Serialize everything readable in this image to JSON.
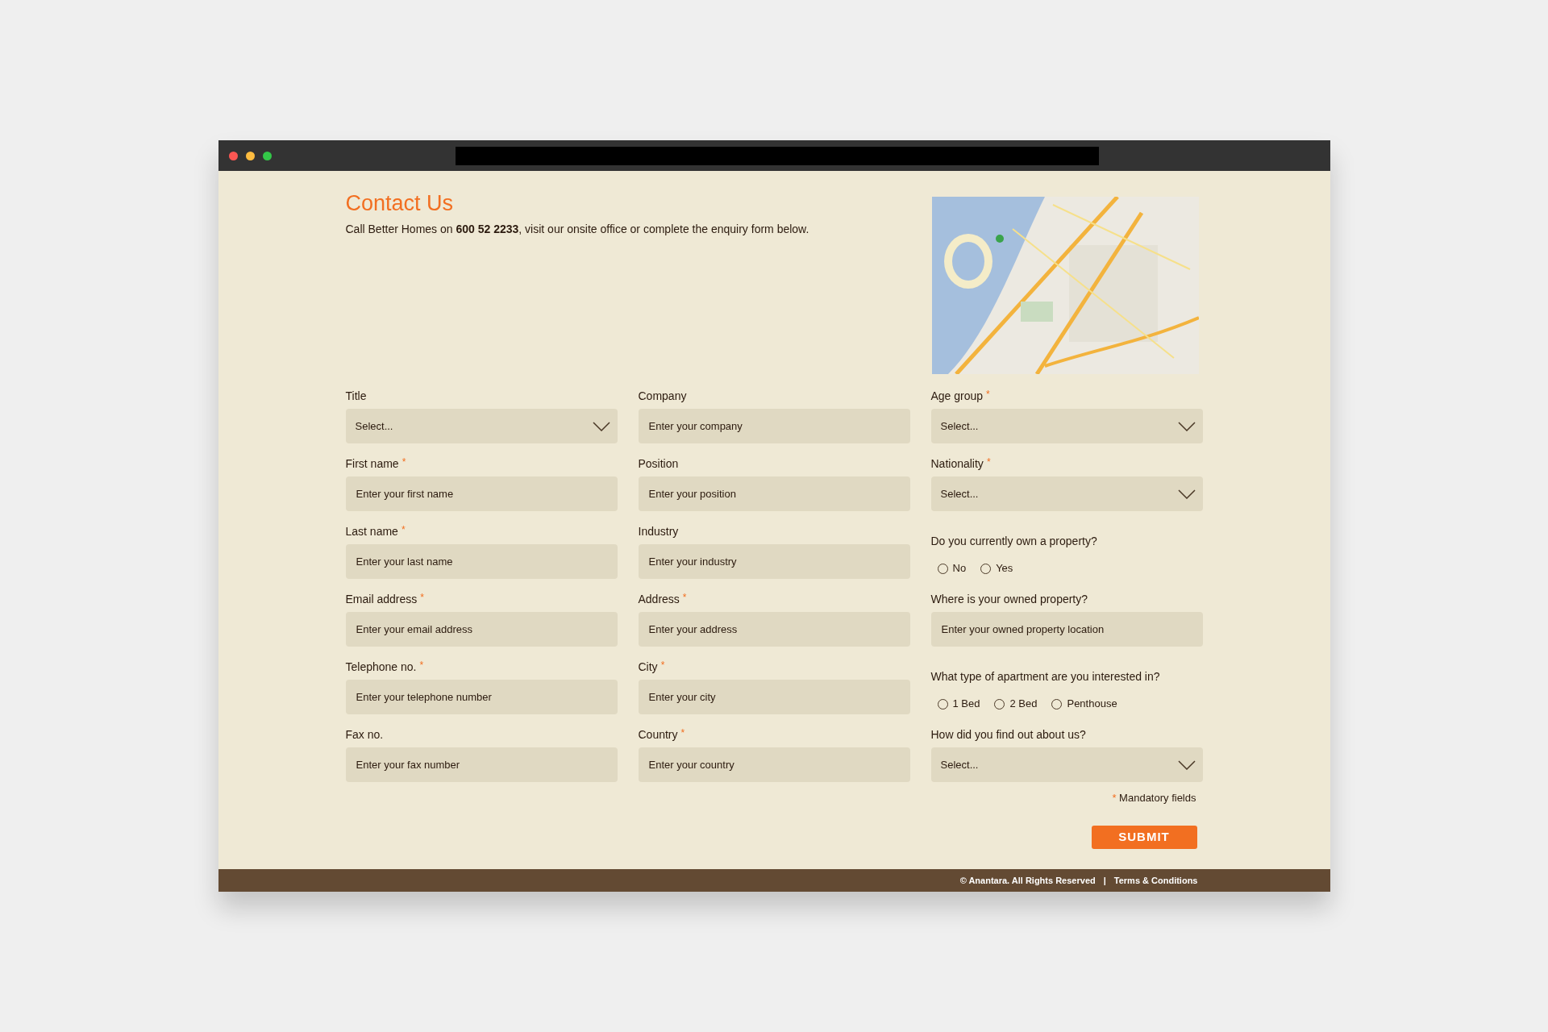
{
  "header": {
    "title": "Contact Us",
    "intro": "Call Better Homes on **600 52 2233**, visit our onsite office or complete the enquiry form below."
  },
  "columns": [
    [
      {
        "kind": "select",
        "label": "Title",
        "value": "Select..."
      },
      {
        "kind": "text",
        "label": "First name",
        "required_mark": "*",
        "placeholder": "Enter your first name"
      },
      {
        "kind": "text",
        "label": "Last name",
        "required_mark": "*",
        "placeholder": "Enter your last name"
      },
      {
        "kind": "text",
        "label": "Email address",
        "required_mark": "*",
        "placeholder": "Enter your email address"
      },
      {
        "kind": "text",
        "label": "Telephone no.",
        "required_mark": "*",
        "placeholder": "Enter your telephone number"
      },
      {
        "kind": "text",
        "label": "Fax no.",
        "placeholder": "Enter your fax number"
      }
    ],
    [
      {
        "kind": "text",
        "label": "Company",
        "placeholder": "Enter your company"
      },
      {
        "kind": "text",
        "label": "Position",
        "placeholder": "Enter your position"
      },
      {
        "kind": "text",
        "label": "Industry",
        "placeholder": "Enter your industry"
      },
      {
        "kind": "text",
        "label": "Address",
        "required_mark": "*",
        "placeholder": "Enter your address"
      },
      {
        "kind": "text",
        "label": "City",
        "required_mark": "*",
        "placeholder": "Enter your city"
      },
      {
        "kind": "text",
        "label": "Country",
        "required_mark": "*",
        "placeholder": "Enter your country"
      }
    ],
    [
      {
        "kind": "select",
        "label": "Age group",
        "required_mark": "*",
        "value": "Select..."
      },
      {
        "kind": "select",
        "label": "Nationality",
        "required_mark": "*",
        "value": "Select..."
      },
      {
        "kind": "radio",
        "label": "Do you currently own a property?",
        "options": [
          {
            "label": "No",
            "selected": false
          },
          {
            "label": "Yes",
            "selected": false
          }
        ]
      },
      {
        "kind": "text",
        "label": "Where is your owned property?",
        "placeholder": "Enter your owned property location"
      },
      {
        "kind": "radio",
        "label": "What type of apartment are you interested in?",
        "options": [
          {
            "label": "1 Bed",
            "selected": false
          },
          {
            "label": "2 Bed",
            "selected": false
          },
          {
            "label": "Penthouse",
            "selected": false
          }
        ]
      },
      {
        "kind": "select",
        "label": "How did you find out about us?",
        "value": "Select..."
      }
    ]
  ],
  "mandatory_note": {
    "mark": "*",
    "text": "Mandatory fields"
  },
  "submit": "SUBMIT",
  "footer": {
    "copyright": "© Anantara. All Rights Reserved",
    "separator": "|",
    "link": "Terms & Conditions"
  }
}
